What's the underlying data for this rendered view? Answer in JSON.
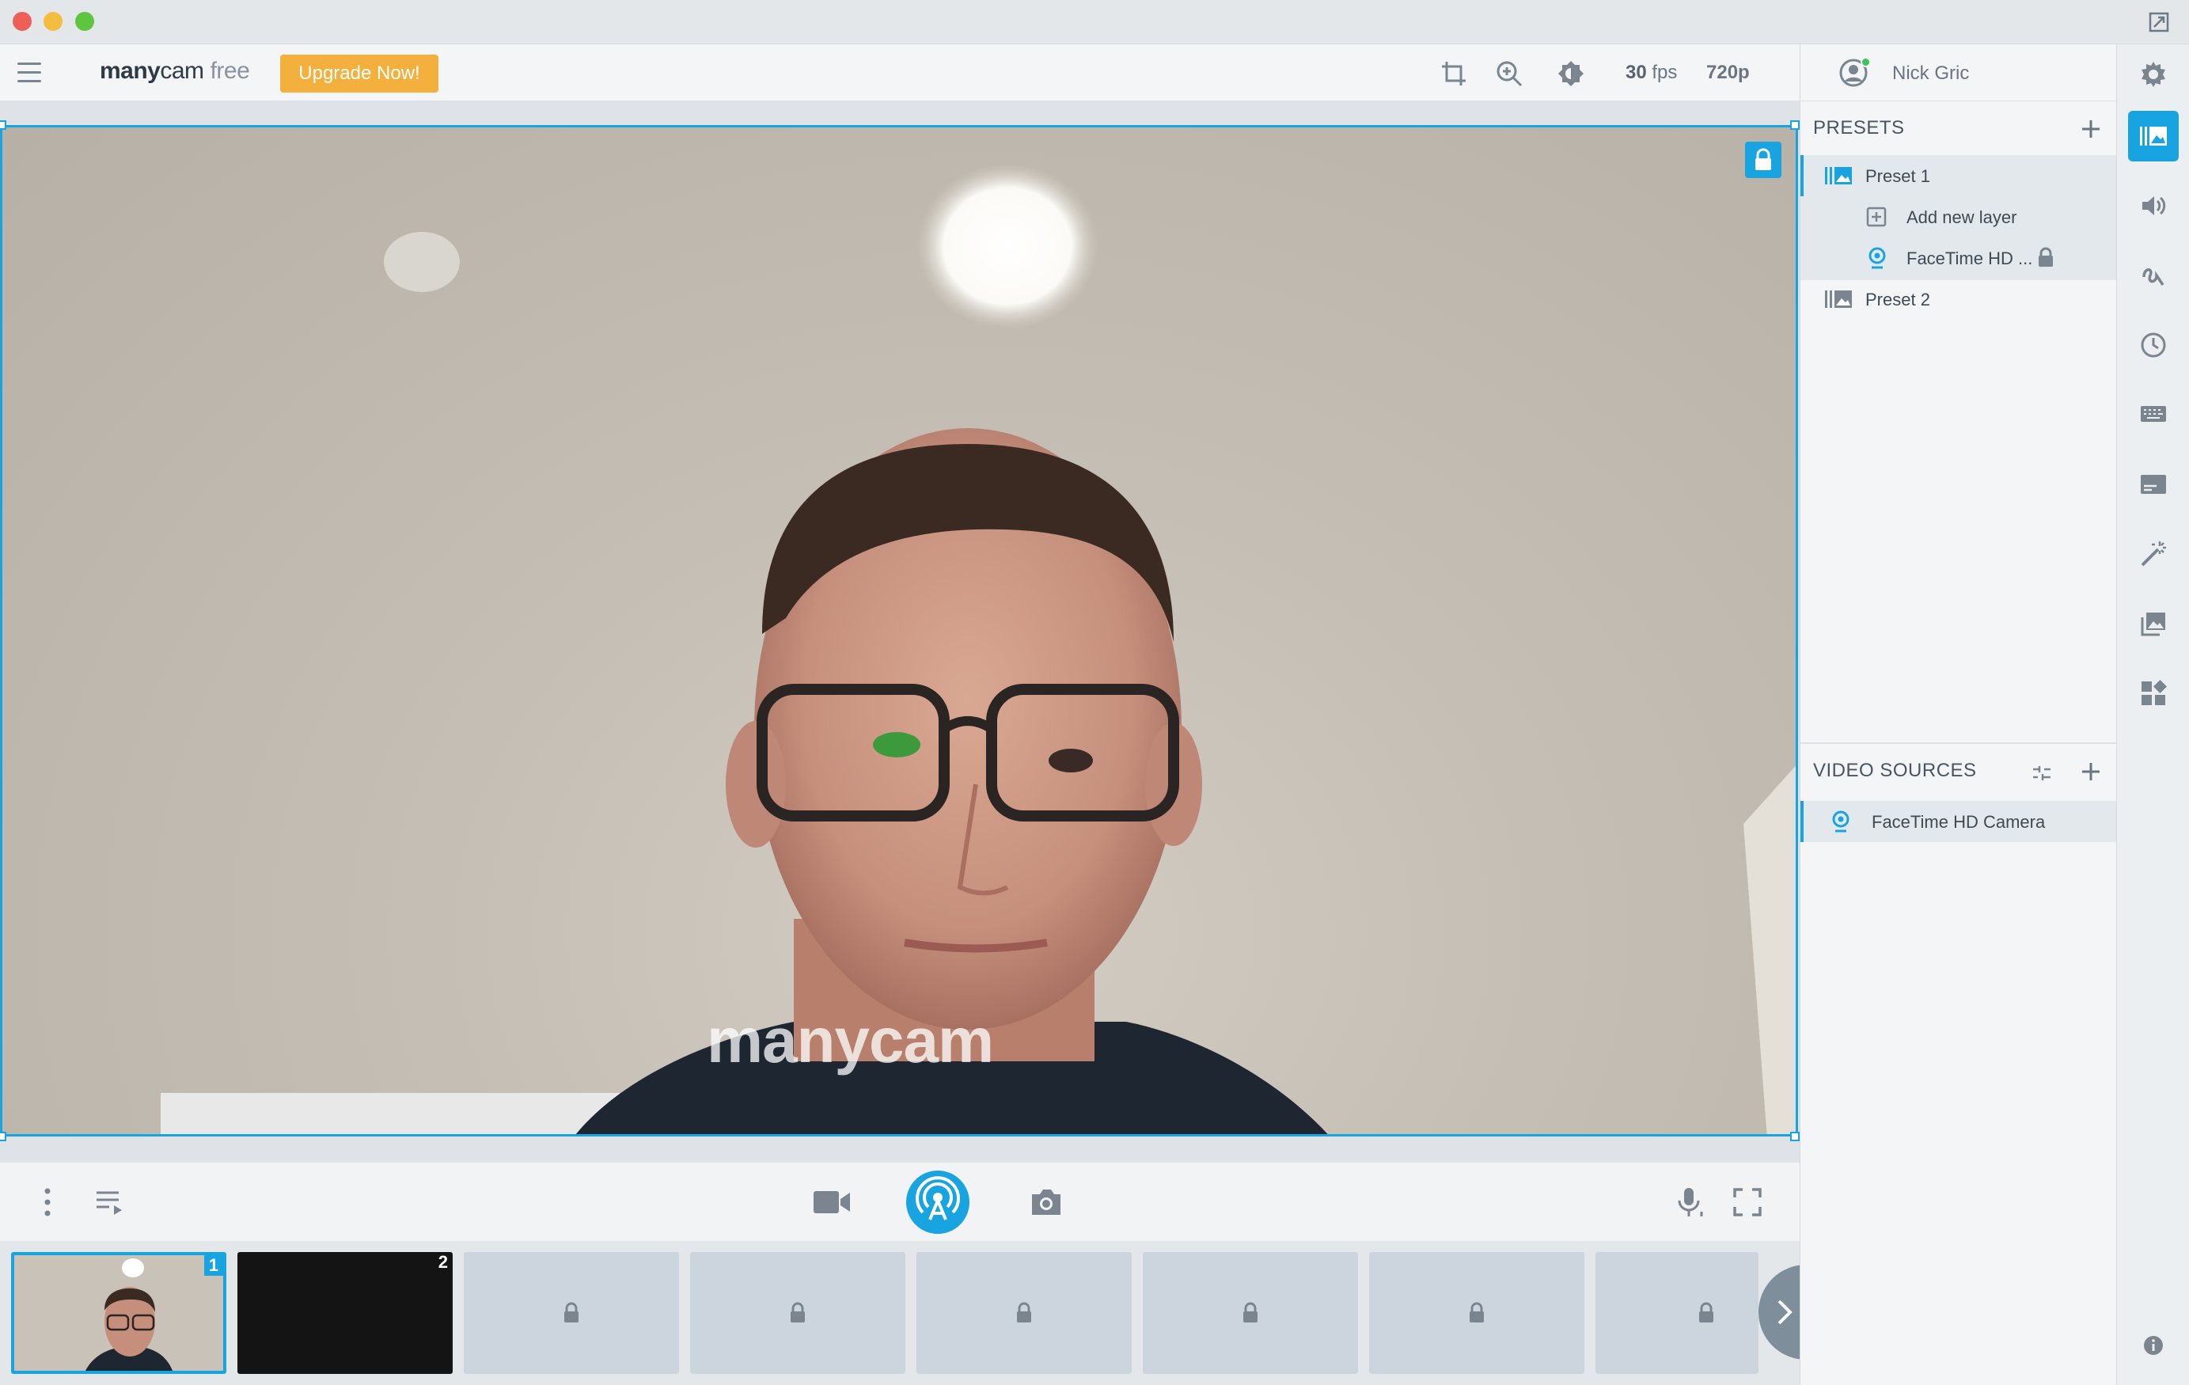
{
  "app": {
    "logo_bold": "many",
    "logo_rest": "cam",
    "logo_edition": "free",
    "upgrade_label": "Upgrade Now!"
  },
  "toolbar": {
    "fps_value": "30",
    "fps_unit": "fps",
    "resolution": "720p",
    "icons": [
      "crop-icon",
      "zoom-icon",
      "brightness-icon"
    ]
  },
  "user": {
    "name": "Nick Gric",
    "status_color": "#3cc45a"
  },
  "presets_panel": {
    "title": "PRESETS",
    "items": [
      {
        "label": "Preset 1",
        "selected": true
      },
      {
        "label": "Add new layer"
      },
      {
        "label": "FaceTime HD ..."
      },
      {
        "label": "Preset 2"
      }
    ]
  },
  "video_sources_panel": {
    "title": "VIDEO SOURCES",
    "items": [
      {
        "label": "FaceTime HD Camera"
      }
    ]
  },
  "video": {
    "watermark": "manycam"
  },
  "strip": {
    "thumbs": [
      {
        "num": "1",
        "state": "active"
      },
      {
        "num": "2",
        "state": "dark"
      },
      {
        "state": "locked"
      },
      {
        "state": "locked"
      },
      {
        "state": "locked"
      },
      {
        "state": "locked"
      },
      {
        "state": "locked"
      },
      {
        "state": "locked"
      }
    ]
  },
  "colors": {
    "accent": "#18a4e0",
    "upgrade": "#f4b03d",
    "window_close": "#ed5f57",
    "window_minimize": "#f5bd40",
    "window_zoom": "#5fc43f"
  }
}
